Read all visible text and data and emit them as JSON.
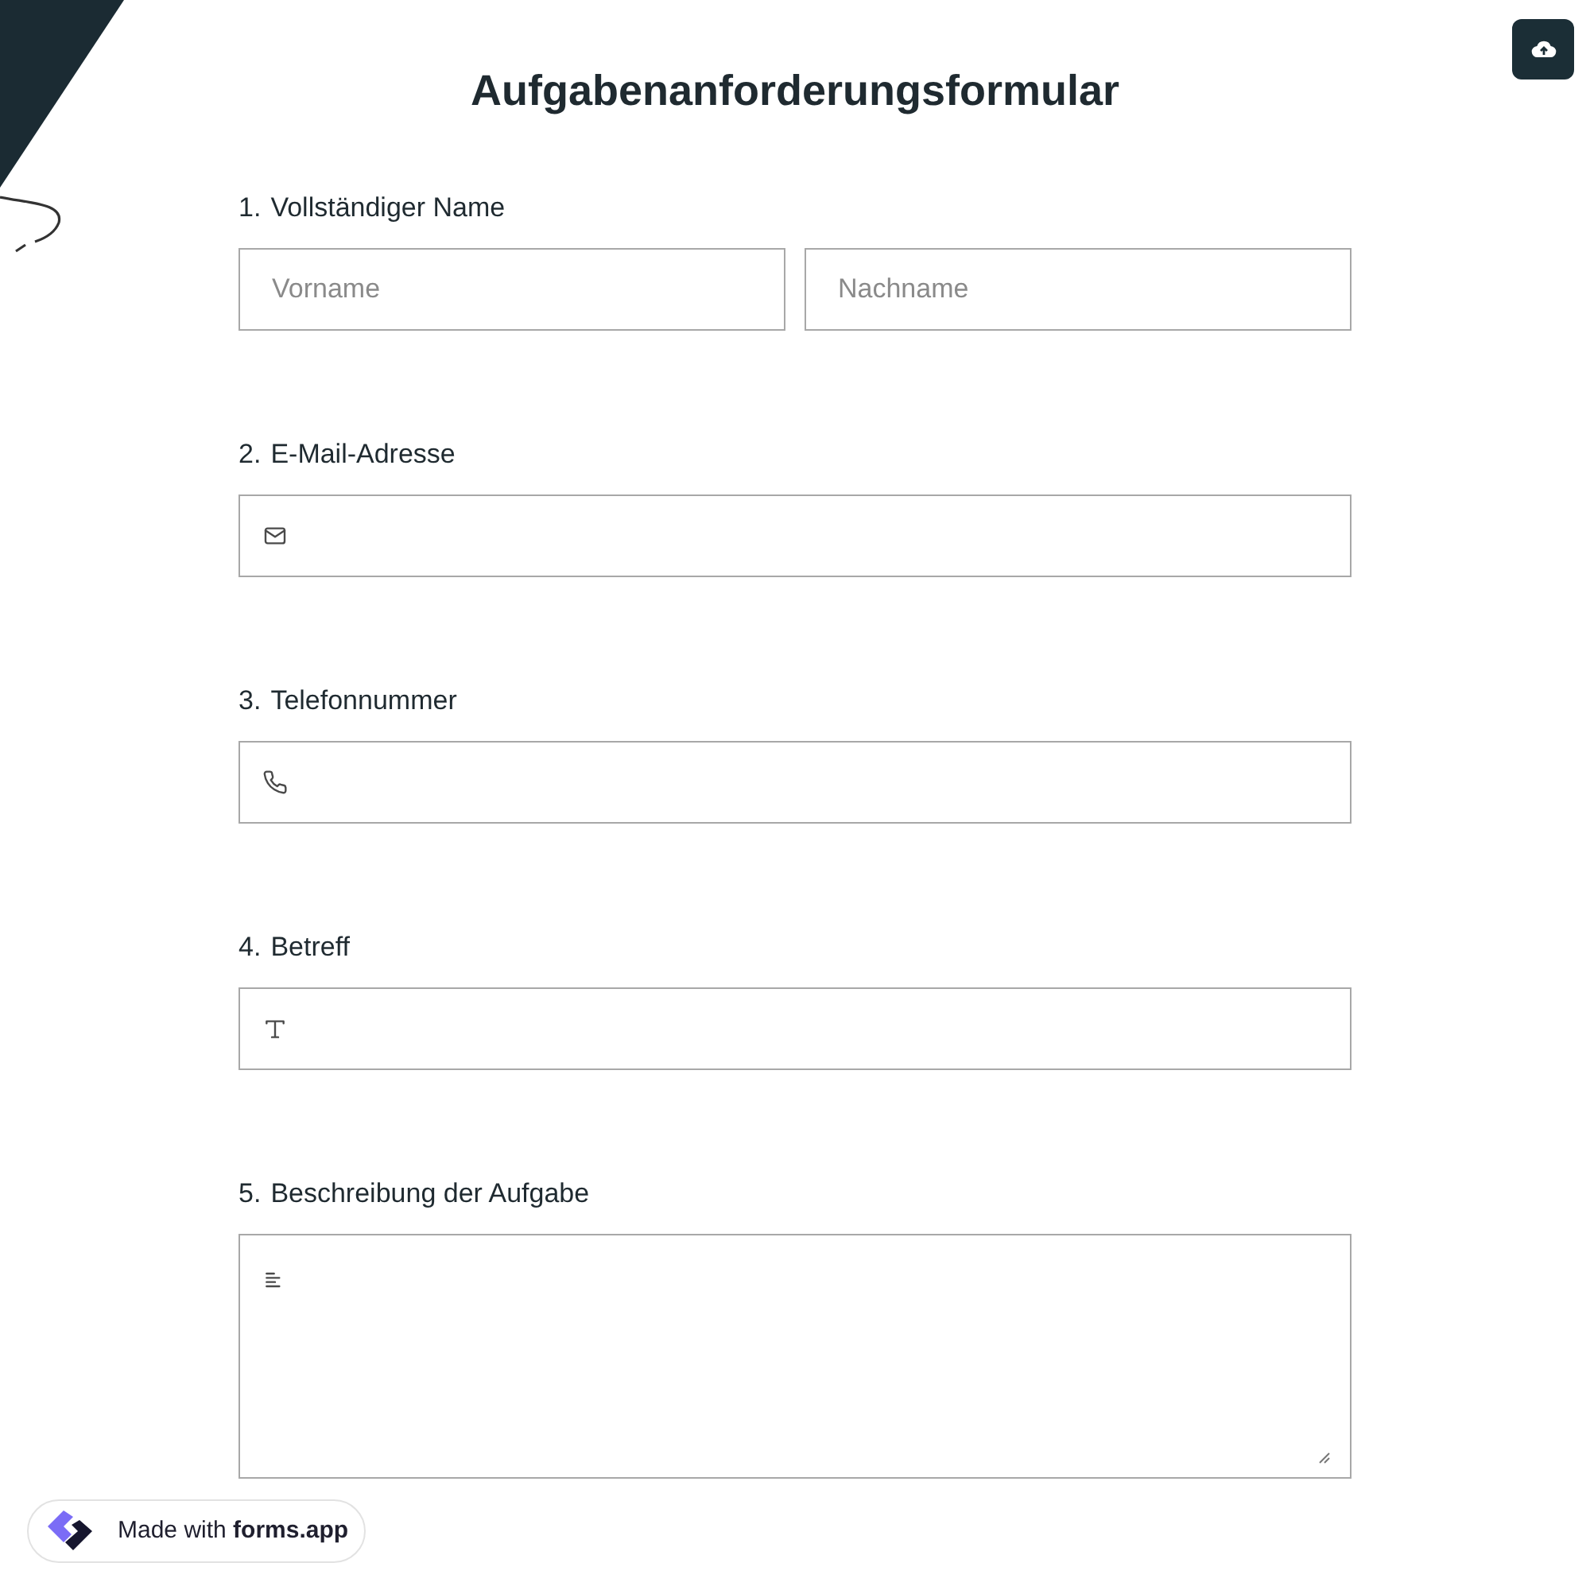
{
  "title": "Aufgabenanforderungsformular",
  "questions": [
    {
      "number": "1.",
      "label": "Vollständiger Name",
      "kind": "name",
      "fields": [
        {
          "placeholder": "Vorname"
        },
        {
          "placeholder": "Nachname"
        }
      ]
    },
    {
      "number": "2.",
      "label": "E-Mail-Adresse",
      "kind": "email"
    },
    {
      "number": "3.",
      "label": "Telefonnummer",
      "kind": "phone"
    },
    {
      "number": "4.",
      "label": "Betreff",
      "kind": "text"
    },
    {
      "number": "5.",
      "label": "Beschreibung der Aufgabe",
      "kind": "textarea"
    }
  ],
  "badge": "Made with **forms.app**"
}
